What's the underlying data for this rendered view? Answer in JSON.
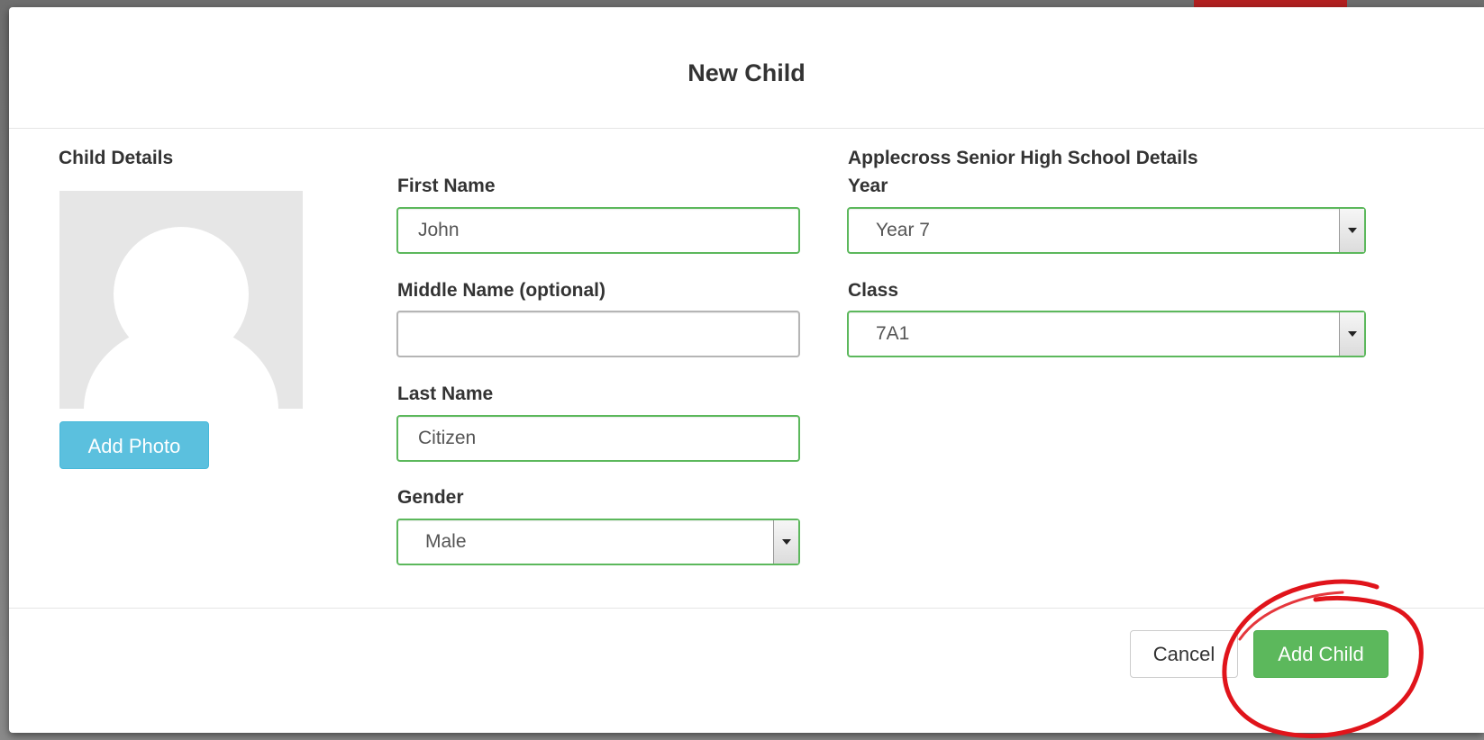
{
  "modal": {
    "title": "New Child"
  },
  "child_details": {
    "heading": "Child Details",
    "add_photo_label": "Add Photo",
    "avatar_icon": "default-user-silhouette"
  },
  "form": {
    "first_name": {
      "label": "First Name",
      "value": "John"
    },
    "middle_name": {
      "label": "Middle Name (optional)",
      "value": ""
    },
    "last_name": {
      "label": "Last Name",
      "value": "Citizen"
    },
    "gender": {
      "label": "Gender",
      "selected": "Male"
    }
  },
  "school": {
    "heading": "Applecross Senior High School Details",
    "year": {
      "label": "Year",
      "selected": "Year 7"
    },
    "class": {
      "label": "Class",
      "selected": "7A1"
    }
  },
  "footer": {
    "cancel_label": "Cancel",
    "add_label": "Add Child"
  },
  "colors": {
    "valid_border": "#5cb85c",
    "info_button": "#5bc0de",
    "success_button": "#5cb85c",
    "annotation": "#e0141b"
  }
}
